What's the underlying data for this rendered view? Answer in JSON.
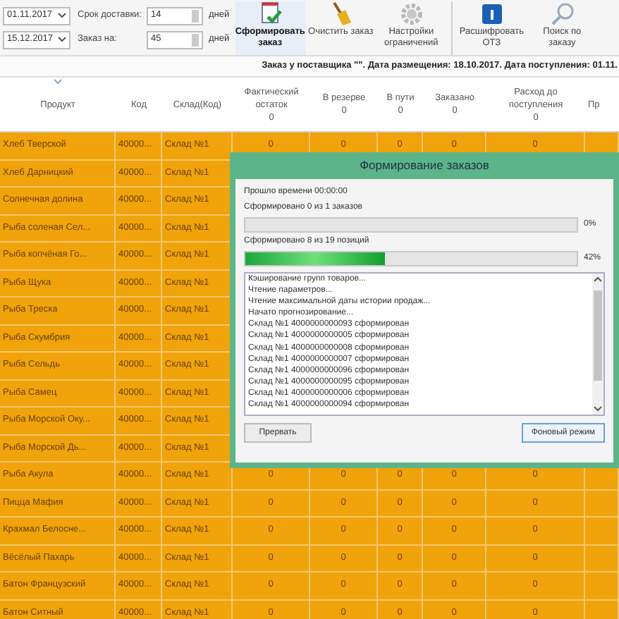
{
  "toolbar": {
    "dates": [
      "01.11.2017",
      "15.12.2017"
    ],
    "fields": [
      {
        "label": "Срок доставки:",
        "value": "14",
        "unit": "дней"
      },
      {
        "label": "Заказ на:",
        "value": "45",
        "unit": "дней"
      }
    ],
    "buttons": [
      {
        "label": "Сформировать заказ",
        "kind": "form",
        "hovered": true
      },
      {
        "label": "Очистить заказ",
        "kind": "clear",
        "hovered": false
      },
      {
        "label": "Настройки ограничений",
        "kind": "settings",
        "hovered": false
      },
      {
        "label": "Расшифровать ОТЗ",
        "kind": "decode",
        "hovered": false
      },
      {
        "label": "Поиск по заказу",
        "kind": "search",
        "hovered": false
      }
    ]
  },
  "info_bar": "Заказ у поставщика \"\". Дата размещения: 18.10.2017. Дата поступления: 01.11.",
  "table": {
    "columns": [
      {
        "label": "Продукт"
      },
      {
        "label": "Код"
      },
      {
        "label": "Склад(Код)"
      },
      {
        "label": "Фактический остаток",
        "total": "0"
      },
      {
        "label": "В резерве",
        "total": "0"
      },
      {
        "label": "В пути",
        "total": "0"
      },
      {
        "label": "Заказано",
        "total": "0"
      },
      {
        "label": "Расход до поступления",
        "total": "0"
      },
      {
        "label": "Пр"
      }
    ],
    "rows": [
      [
        "Хлеб Тверской",
        "40000...",
        "Склад №1",
        "0",
        "0",
        "0",
        "0",
        "0"
      ],
      [
        "Хлеб Дарницкий",
        "40000...",
        "Склад №1"
      ],
      [
        "Солнечная долина",
        "40000...",
        "Склад №1"
      ],
      [
        "Рыба соленая Сел...",
        "40000...",
        "Склад №1"
      ],
      [
        "Рыба копчёная Го...",
        "40000...",
        "Склад №1"
      ],
      [
        "Рыба Щука",
        "40000...",
        "Склад №1"
      ],
      [
        "Рыба Треска",
        "40000...",
        "Склад №1"
      ],
      [
        "Рыба Скумбрия",
        "40000...",
        "Склад №1"
      ],
      [
        "Рыба Сельдь",
        "40000...",
        "Склад №1"
      ],
      [
        "Рыба Самец",
        "40000...",
        "Склад №1"
      ],
      [
        "Рыба Морской Оку...",
        "40000...",
        "Склад №1"
      ],
      [
        "Рыба Морской Дь...",
        "40000...",
        "Склад №1"
      ],
      [
        "Рыба Акула",
        "40000...",
        "Склад №1",
        "0",
        "0",
        "0",
        "0",
        "0"
      ],
      [
        "Пицца Мафия",
        "40000...",
        "Склад №1",
        "0",
        "0",
        "0",
        "0",
        "0"
      ],
      [
        "Крахмал Белосне...",
        "40000...",
        "Склад №1",
        "0",
        "0",
        "0",
        "0",
        "0"
      ],
      [
        "Вёсёлый Пахарь",
        "40000...",
        "Склад №1",
        "0",
        "0",
        "0",
        "0",
        "0"
      ],
      [
        "Батон Французский",
        "40000...",
        "Склад №1",
        "0",
        "0",
        "0",
        "0",
        "0"
      ],
      [
        "Батон Ситный",
        "40000...",
        "Склад №1",
        "0",
        "0",
        "0",
        "0",
        "0"
      ]
    ]
  },
  "dialog": {
    "title": "Формирование заказов",
    "elapsed": "Прошло времени 00:00:00",
    "progress": [
      {
        "label": "Сформировано 0 из 1 заказов",
        "level": 0,
        "reading": "0%"
      },
      {
        "label": "Сформировано 8 из 19 позиций",
        "level": 0.42,
        "reading": "42%"
      }
    ],
    "log": [
      "Кэширование групп товаров...",
      "Чтение параметров...",
      "Чтение максимальной даты истории продаж...",
      "Начато прогнозирование...",
      "Склад №1 4000000000093 сформирован",
      "Склад №1 4000000000005 сформирован",
      "Склад №1 4000000000008 сформирован",
      "Склад №1 4000000000007 сформирован",
      "Склад №1 4000000000096 сформирован",
      "Склад №1 4000000000095 сформирован",
      "Склад №1 4000000000006 сформирован",
      "Склад №1 4000000000094 сформирован"
    ],
    "buttons": [
      "Прервать",
      "Фоновый режим"
    ]
  }
}
